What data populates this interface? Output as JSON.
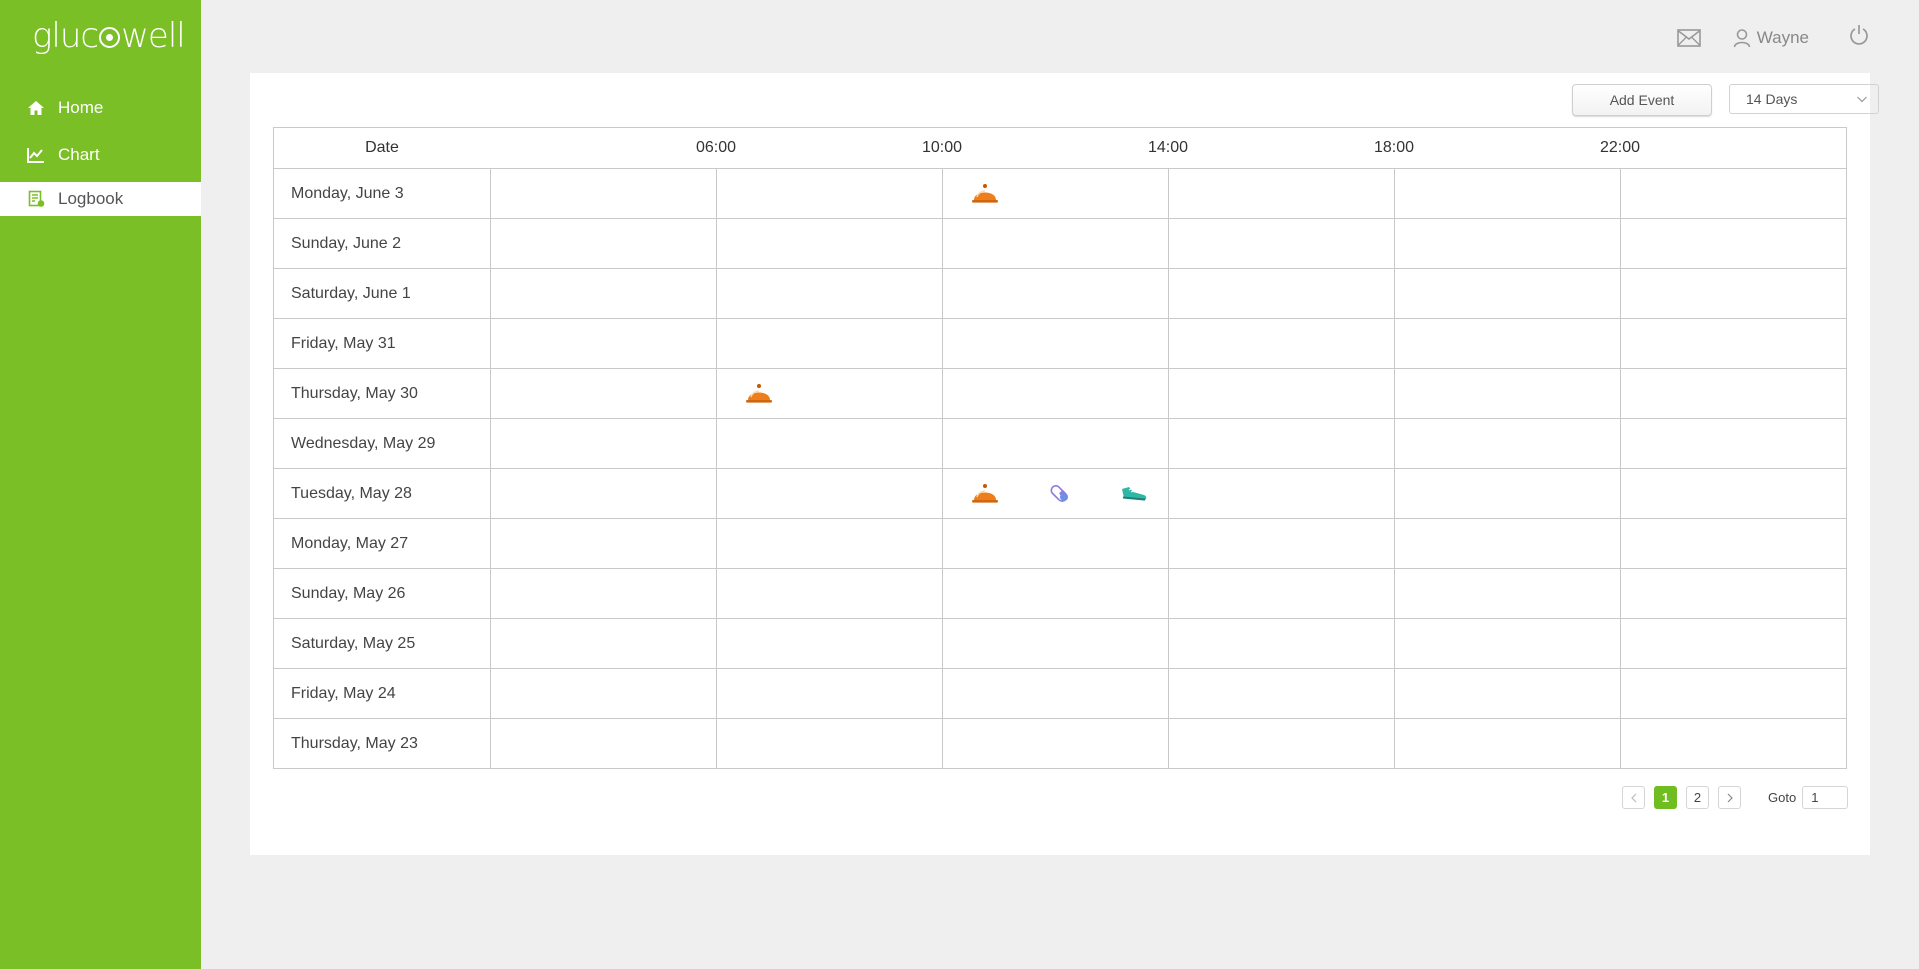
{
  "app": {
    "logo_pre": "gluc",
    "logo_post": "well"
  },
  "sidebar": {
    "items": [
      {
        "label": "Home",
        "icon": "home-icon"
      },
      {
        "label": "Chart",
        "icon": "chart-icon"
      },
      {
        "label": "Logbook",
        "icon": "logbook-icon",
        "active": true
      }
    ]
  },
  "header": {
    "user_name": "Wayne",
    "icons": [
      "mail-icon",
      "user-icon",
      "power-icon"
    ]
  },
  "toolbar": {
    "add_event_label": "Add Event",
    "range_value": "14 Days"
  },
  "grid": {
    "date_header": "Date",
    "time_ticks": [
      "06:00",
      "10:00",
      "14:00",
      "18:00",
      "22:00"
    ],
    "rows": [
      {
        "date": "Monday, June 3",
        "events": [
          {
            "type": "meal",
            "icon": "meal-icon"
          }
        ]
      },
      {
        "date": "Sunday, June 2",
        "events": []
      },
      {
        "date": "Saturday, June 1",
        "events": []
      },
      {
        "date": "Friday, May 31",
        "events": []
      },
      {
        "date": "Thursday, May 30",
        "events": [
          {
            "type": "meal",
            "icon": "meal-icon"
          }
        ]
      },
      {
        "date": "Wednesday, May 29",
        "events": []
      },
      {
        "date": "Tuesday, May 28",
        "events": [
          {
            "type": "meal",
            "icon": "meal-icon"
          },
          {
            "type": "medication",
            "icon": "pill-icon"
          },
          {
            "type": "exercise",
            "icon": "shoe-icon"
          }
        ]
      },
      {
        "date": "Monday, May 27",
        "events": []
      },
      {
        "date": "Sunday, May 26",
        "events": []
      },
      {
        "date": "Saturday, May 25",
        "events": []
      },
      {
        "date": "Friday, May 24",
        "events": []
      },
      {
        "date": "Thursday, May 23",
        "events": []
      }
    ]
  },
  "pagination": {
    "pages": [
      "1",
      "2"
    ],
    "current": "1",
    "goto_label": "Goto",
    "goto_value": "1"
  },
  "colors": {
    "brand_green": "#7abf26",
    "meal_orange": "#ee7d1b",
    "pill_purple": "#8e7be0",
    "shoe_teal": "#2eb6a6"
  }
}
